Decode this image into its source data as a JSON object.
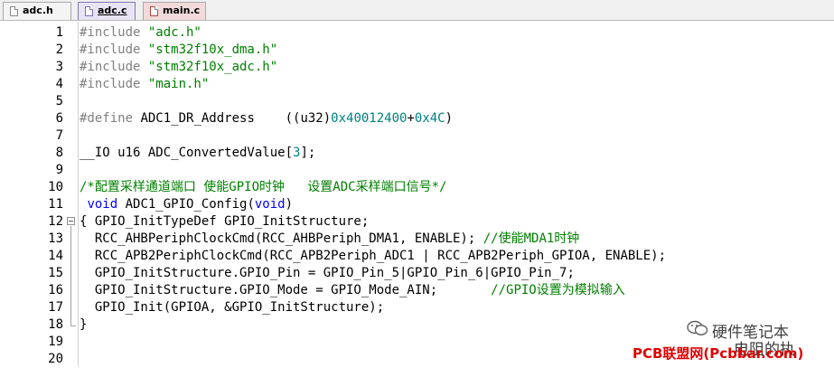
{
  "tabs": [
    {
      "label": "adc.h",
      "icon": "file-h-icon"
    },
    {
      "label": "adc.c",
      "icon": "file-c-icon"
    },
    {
      "label": "main.c",
      "icon": "file-c-icon"
    }
  ],
  "lines": [
    {
      "n": "1",
      "segs": [
        {
          "t": "#include ",
          "c": "pp"
        },
        {
          "t": "\"adc.h\"",
          "c": "str"
        }
      ]
    },
    {
      "n": "2",
      "segs": [
        {
          "t": "#include ",
          "c": "pp"
        },
        {
          "t": "\"stm32f10x_dma.h\"",
          "c": "str"
        }
      ]
    },
    {
      "n": "3",
      "segs": [
        {
          "t": "#include ",
          "c": "pp"
        },
        {
          "t": "\"stm32f10x_adc.h\"",
          "c": "str"
        }
      ]
    },
    {
      "n": "4",
      "segs": [
        {
          "t": "#include ",
          "c": "pp"
        },
        {
          "t": "\"main.h\"",
          "c": "str"
        }
      ]
    },
    {
      "n": "5",
      "segs": []
    },
    {
      "n": "6",
      "segs": [
        {
          "t": "#define ",
          "c": "pp"
        },
        {
          "t": "ADC1_DR_Address    ((u32)",
          "c": ""
        },
        {
          "t": "0x40012400",
          "c": "num"
        },
        {
          "t": "+",
          "c": ""
        },
        {
          "t": "0x4C",
          "c": "num"
        },
        {
          "t": ")",
          "c": ""
        }
      ]
    },
    {
      "n": "7",
      "segs": []
    },
    {
      "n": "8",
      "segs": [
        {
          "t": "__IO u16 ADC_ConvertedValue[",
          "c": ""
        },
        {
          "t": "3",
          "c": "num"
        },
        {
          "t": "];",
          "c": ""
        }
      ]
    },
    {
      "n": "9",
      "segs": []
    },
    {
      "n": "10",
      "segs": [
        {
          "t": "/*配置采样通道端口 使能GPIO时钟   设置ADC采样端口信号*/",
          "c": "cm"
        }
      ]
    },
    {
      "n": "11",
      "segs": [
        {
          "t": " ",
          "c": ""
        },
        {
          "t": "void",
          "c": "kw"
        },
        {
          "t": " ADC1_GPIO_Config(",
          "c": ""
        },
        {
          "t": "void",
          "c": "kw"
        },
        {
          "t": ")",
          "c": ""
        }
      ]
    },
    {
      "n": "12",
      "fold": true,
      "segs": [
        {
          "t": "{ GPIO_InitTypeDef GPIO_InitStructure;",
          "c": ""
        }
      ]
    },
    {
      "n": "13",
      "segs": [
        {
          "t": "  RCC_AHBPeriphClockCmd(RCC_AHBPeriph_DMA1, ENABLE); ",
          "c": ""
        },
        {
          "t": "//使能MDA1时钟",
          "c": "cm"
        }
      ]
    },
    {
      "n": "14",
      "segs": [
        {
          "t": "  RCC_APB2PeriphClockCmd(RCC_APB2Periph_ADC1 | RCC_APB2Periph_GPIOA, ENABLE);",
          "c": ""
        }
      ]
    },
    {
      "n": "15",
      "segs": [
        {
          "t": "  GPIO_InitStructure.GPIO_Pin = GPIO_Pin_5|GPIO_Pin_6|GPIO_Pin_7;",
          "c": ""
        }
      ]
    },
    {
      "n": "16",
      "segs": [
        {
          "t": "  GPIO_InitStructure.GPIO_Mode = GPIO_Mode_AIN;       ",
          "c": ""
        },
        {
          "t": "//GPIO设置为模拟输入",
          "c": "cm"
        }
      ]
    },
    {
      "n": "17",
      "segs": [
        {
          "t": "  GPIO_Init(GPIOA, &GPIO_InitStructure);",
          "c": ""
        }
      ]
    },
    {
      "n": "18",
      "segs": [
        {
          "t": "}",
          "c": ""
        }
      ]
    },
    {
      "n": "19",
      "segs": []
    },
    {
      "n": "20",
      "segs": []
    }
  ],
  "watermark": {
    "account": "硬件笔记本",
    "author": "电阻的执",
    "site": "PCB联盟网(Pcbbar.com)"
  },
  "colors": {
    "preprocessor": "#808080",
    "string": "#008000",
    "comment": "#008000",
    "number": "#008080",
    "keyword": "#0000ff"
  }
}
